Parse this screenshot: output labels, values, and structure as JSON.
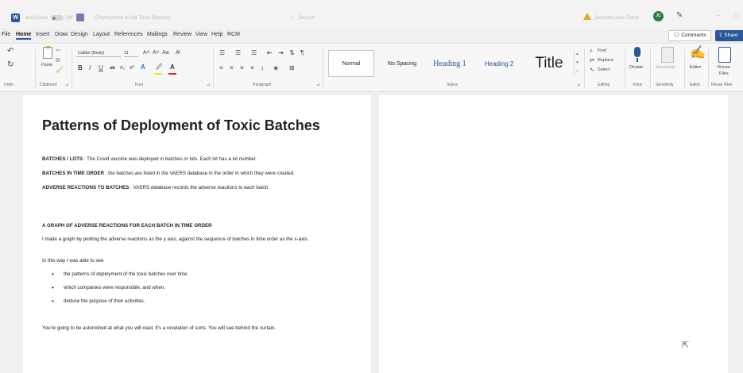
{
  "titlebar": {
    "autosave_label": "AutoSave",
    "toggle_state": "Off",
    "doc_name": "Deployment of the Toxic Batches",
    "search_placeholder": "Search",
    "user_name": "JaneMcLean Claire",
    "avatar_initials": "JC"
  },
  "menu": {
    "items": [
      "File",
      "Home",
      "Insert",
      "Draw",
      "Design",
      "Layout",
      "References",
      "Mailings",
      "Review",
      "View",
      "Help",
      "RCM"
    ],
    "active": "Home",
    "comments_label": "Comments",
    "share_label": "Share"
  },
  "ribbon": {
    "undo_label": "Undo",
    "clipboard_label": "Clipboard",
    "paste_label": "Paste",
    "font_label": "Font",
    "font_name": "Calibri (Body)",
    "font_size": "11",
    "paragraph_label": "Paragraph",
    "styles_label": "Styles",
    "styles": [
      "Normal",
      "No Spacing",
      "Heading 1",
      "Heading 2",
      "Title"
    ],
    "editing_label": "Editing",
    "find_label": "Find",
    "replace_label": "Replace",
    "select_label": "Select",
    "dictate_label": "Dictate",
    "voice_label": "Voice",
    "sensitivity_label": "Sensitivity",
    "sensitivity_btn": "Sensitivity",
    "editor_label": "Editor",
    "editor_btn": "Editor",
    "reuse_files_label": "Reuse Files",
    "reuse_line1": "Reuse",
    "reuse_line2": "Files",
    "accent_color": "#2b579a"
  },
  "document": {
    "title": "Patterns of Deployment of Toxic Batches",
    "p1_bold": "BATCHES / LOTS",
    "p1_text": " : The Covid vaccine was deployed in batches or lots. Each lot has a lot number.",
    "p2_bold": "BATCHES IN TIME ORDER",
    "p2_text": " : the batches are listed in the VAERS database in the order in which they were created.",
    "p3_bold": "ADVERSE REACTIONS TO BATCHES",
    "p3_text": " : VAERS database records the adverse reactions to each batch.",
    "heading2": "A GRAPH OF ADVERSE REACTIONS FOR EACH BATCH IN TIME ORDER",
    "p4": "I made a graph by plotting the adverse reactions as the y axis, against the sequence of batches in time order as the x-axis.",
    "p5": "In this way I was able to see",
    "bullets": [
      "the patterns of deployment of the toxic batches over time.",
      "which companies were responsible, and when.",
      "deduce the purpose of their activities."
    ],
    "p6": "You're going to be astonished at what you will read. It's a revelation of sorts. You will see behind the curtain."
  }
}
